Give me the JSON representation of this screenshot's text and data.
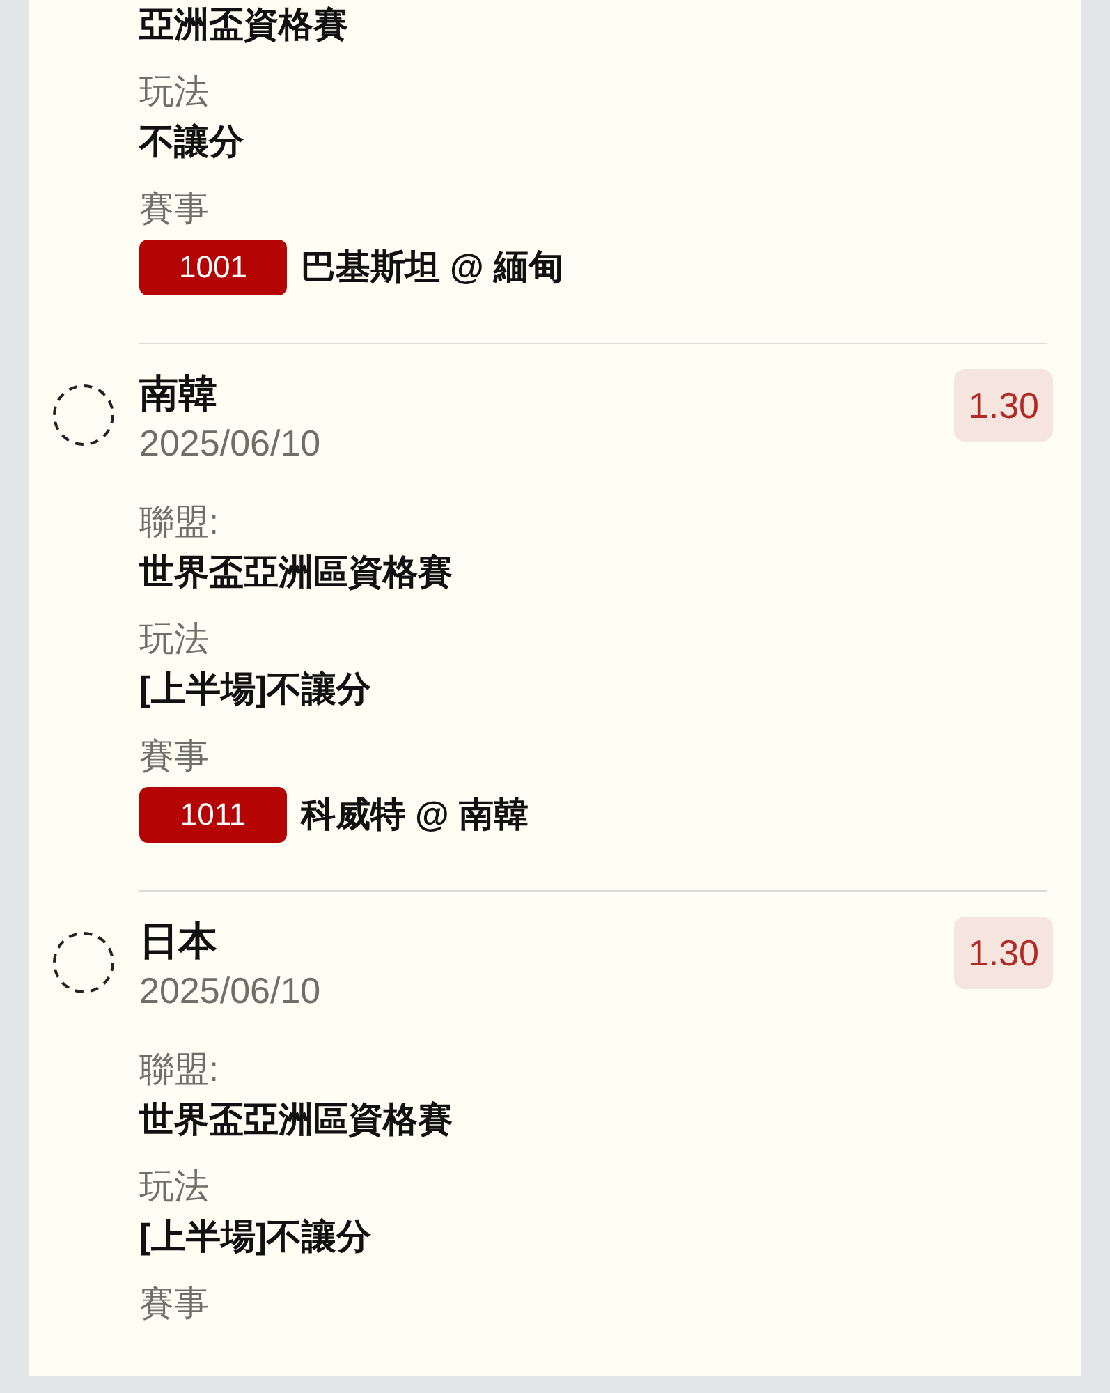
{
  "bets": [
    {
      "fields": [
        {
          "value": "亞洲盃資格賽"
        },
        {
          "label": "玩法",
          "value": "不讓分"
        }
      ],
      "event_label": "賽事",
      "event_code": "1001",
      "event_match": "巴基斯坦 @ 緬甸"
    },
    {
      "team": "南韓",
      "date": "2025/06/10",
      "odds": "1.30",
      "fields": [
        {
          "label": "聯盟:",
          "value": "世界盃亞洲區資格賽"
        },
        {
          "label": "玩法",
          "value": "[上半場]不讓分"
        }
      ],
      "event_label": "賽事",
      "event_code": "1011",
      "event_match": "科威特 @ 南韓"
    },
    {
      "team": "日本",
      "date": "2025/06/10",
      "odds": "1.30",
      "fields": [
        {
          "label": "聯盟:",
          "value": "世界盃亞洲區資格賽"
        },
        {
          "label": "玩法",
          "value": "[上半場]不讓分"
        }
      ],
      "event_label": "賽事"
    }
  ]
}
